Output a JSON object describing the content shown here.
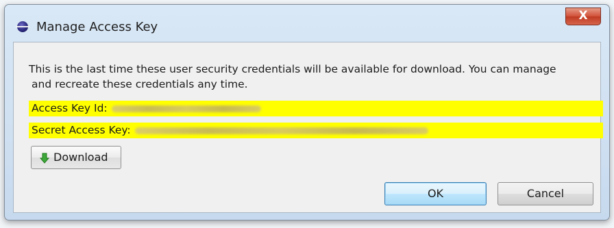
{
  "window": {
    "title": "Manage Access Key",
    "close_glyph": "X"
  },
  "message": {
    "line1": "This is the last time these user security credentials will be available for download. You can manage",
    "line2": "and recreate these credentials any time."
  },
  "credentials": {
    "access_key_label": "Access Key Id:",
    "secret_key_label": "Secret Access Key:"
  },
  "buttons": {
    "download": "Download",
    "ok": "OK",
    "cancel": "Cancel"
  },
  "colors": {
    "highlight": "#ffff00",
    "close_button": "#c03a23",
    "default_button_border": "#3c7fb1",
    "download_arrow": "#3ea83a"
  },
  "icons": {
    "app": "eclipse-icon",
    "close": "close-icon",
    "download": "green-down-arrow-icon"
  }
}
